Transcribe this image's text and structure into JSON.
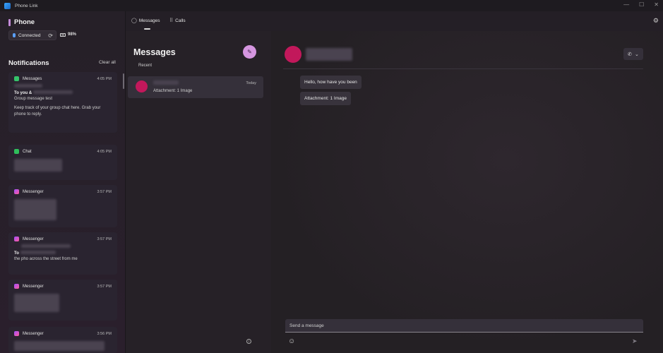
{
  "window": {
    "title": "Phone Link",
    "controls": [
      "—",
      "☐",
      "✕"
    ]
  },
  "sidebar": {
    "phone_title": "Phone",
    "connection": "Connected",
    "battery": "98%",
    "notifications_title": "Notifications",
    "clear_all": "Clear all",
    "notifications": [
      {
        "app": "Messages",
        "time": "4:05 PM",
        "to_line": "To you &",
        "subtitle": "Group message test",
        "body": "Keep track of your group chat here. Grab your phone to reply."
      },
      {
        "app": "Chat",
        "time": "4:05 PM"
      },
      {
        "app": "Messenger",
        "time": "3:57 PM"
      },
      {
        "app": "Messenger",
        "time": "3:57 PM",
        "to_line": "To",
        "body": "the pho across the street from me"
      },
      {
        "app": "Messenger",
        "time": "3:57 PM"
      },
      {
        "app": "Messenger",
        "time": "3:56 PM"
      }
    ]
  },
  "topnav": {
    "tabs": [
      {
        "label": "Messages"
      },
      {
        "label": "Calls"
      }
    ]
  },
  "messages_pane": {
    "title": "Messages",
    "recent_label": "Recent",
    "conversation": {
      "time": "Today",
      "preview": "Attachment: 1 Image"
    }
  },
  "conversation_pane": {
    "messages": [
      "Hello, how have you been",
      "Attachment: 1 Image"
    ],
    "input_placeholder": "Send a message"
  },
  "icons": {
    "sync": "⟳",
    "compose": "✎",
    "settings": "⚙",
    "phone": "✆",
    "chevron": "⌄",
    "emoji": "☺",
    "send": "➤",
    "info": "i",
    "messages_tab": "◯",
    "calls_tab": "⠿"
  },
  "colors": {
    "accent": "#d596e0",
    "avatar": "#c2185b",
    "background": "#241f26"
  }
}
